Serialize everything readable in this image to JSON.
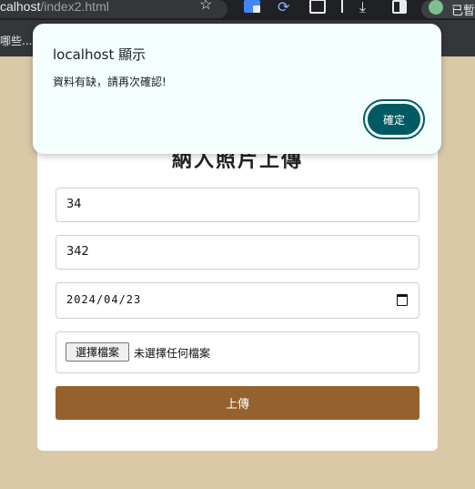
{
  "browser": {
    "address_host": "calhost",
    "address_path": "/index2.html",
    "profile_label": "已暫",
    "bookmark_text": "哪些..."
  },
  "dialog": {
    "title": "localhost 顯示",
    "message": "資料有缺，請再次確認!",
    "ok_label": "確定"
  },
  "form": {
    "title": "納入照片上傳",
    "name_value": "34",
    "phone_value": "342",
    "date_value": "2024/04/23",
    "file_button_label": "選擇檔案",
    "file_status": "未選擇任何檔案",
    "submit_label": "上傳"
  },
  "colors": {
    "page_background": "#d9c9a7",
    "submit_button": "#94612f",
    "dialog_button": "#005a63",
    "dialog_background": "#f4fffe"
  },
  "icons": [
    "star-icon",
    "translate-extension-icon",
    "sync-extension-icon",
    "extensions-puzzle-icon",
    "download-icon",
    "side-panel-icon",
    "profile-avatar-icon",
    "calendar-icon"
  ]
}
